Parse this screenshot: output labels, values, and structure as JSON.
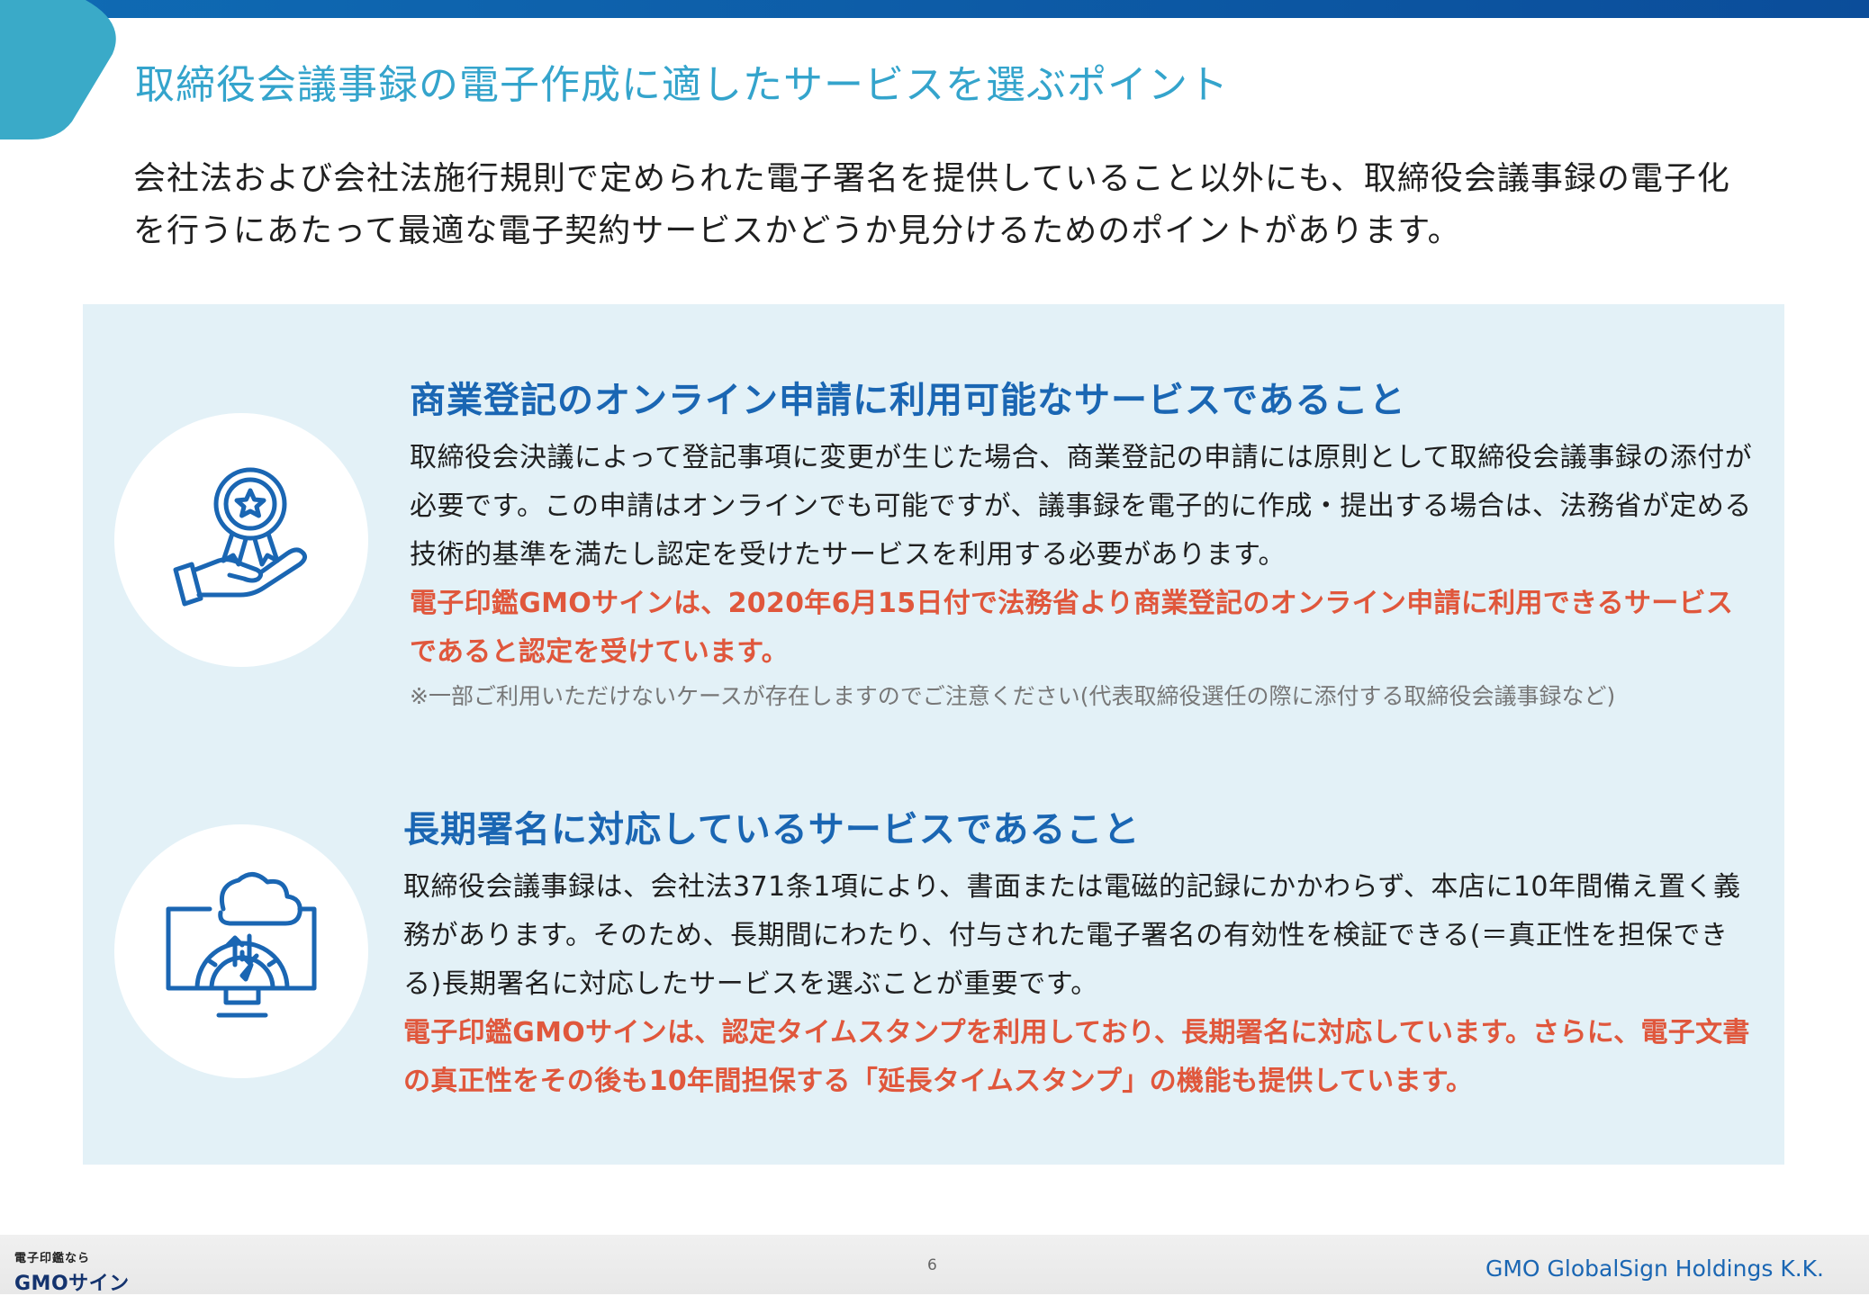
{
  "header": {
    "title": "取締役会議事録の電子作成に適したサービスを選ぶポイント"
  },
  "intro": "会社法および会社法施行規則で定められた電子署名を提供していること以外にも、取締役会議事録の電子化を行うにあたって最適な電子契約サービスかどうか見分けるためのポイントがあります。",
  "points": [
    {
      "icon": "award-hand-icon",
      "heading": "商業登記のオンライン申請に利用可能なサービスであること",
      "body": "取締役会決議によって登記事項に変更が生じた場合、商業登記の申請には原則として取締役会議事録の添付が必要です。この申請はオンラインでも可能ですが、議事録を電子的に作成・提出する場合は、法務省が定める技術的基準を満たし認定を受けたサービスを利用する必要があります。",
      "highlight": "電子印鑑GMOサインは、2020年6月15日付で法務省より商業登記のオンライン申請に利用できるサービスであると認定を受けています。",
      "note": "※一部ご利用いただけないケースが存在しますのでご注意ください(代表取締役選任の際に添付する取締役会議事録など)"
    },
    {
      "icon": "cloud-monitor-gauge-icon",
      "heading": "長期署名に対応しているサービスであること",
      "body": "取締役会議事録は、会社法371条1項により、書面または電磁的記録にかかわらず、本店に10年間備え置く義務があります。そのため、長期間にわたり、付与された電子署名の有効性を検証できる(＝真正性を担保できる)長期署名に対応したサービスを選ぶことが重要です。",
      "highlight": "電子印鑑GMOサインは、認定タイムスタンプを利用しており、長期署名に対応しています。さらに、電子文書の真正性をその後も10年間担保する「延長タイムスタンプ」の機能も提供しています。"
    }
  ],
  "footer": {
    "logo_small": "電子印鑑なら",
    "logo_main_gmo": "GMO",
    "logo_main_sign": "サイン",
    "page_number": "6",
    "company": "GMO GlobalSign Holdings K.K."
  },
  "colors": {
    "title": "#34a4cc",
    "heading": "#1a66b3",
    "highlight": "#e0573c",
    "panel": "#e3f1f7",
    "topbar": "#0f6bb4"
  }
}
